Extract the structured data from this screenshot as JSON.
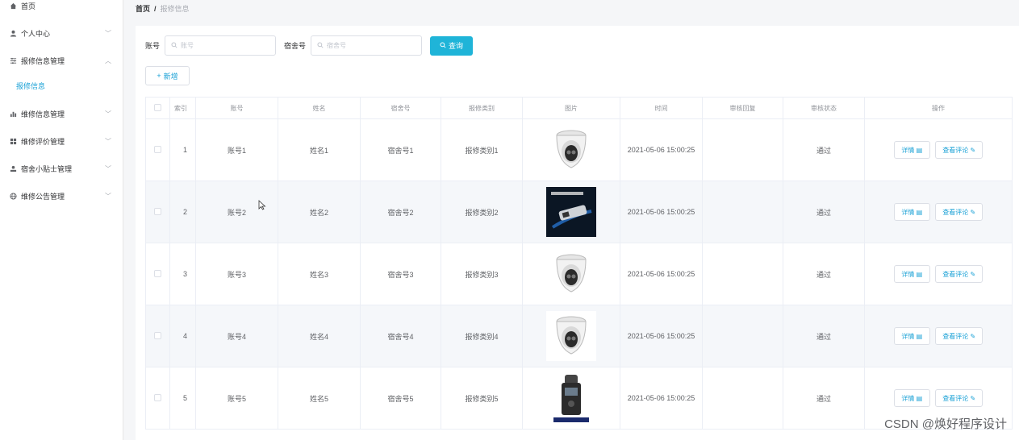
{
  "sidebar": {
    "items": [
      {
        "label": "首页",
        "icon": "home-icon",
        "has_chevron": false
      },
      {
        "label": "个人中心",
        "icon": "user-icon",
        "has_chevron": true
      },
      {
        "label": "报修信息管理",
        "icon": "sliders-icon",
        "has_chevron": true,
        "expanded": true
      },
      {
        "label": "维修信息管理",
        "icon": "bar-chart-icon",
        "has_chevron": true
      },
      {
        "label": "维修评价管理",
        "icon": "grid-icon",
        "has_chevron": true
      },
      {
        "label": "宿舍小贴士管理",
        "icon": "person-icon",
        "has_chevron": true
      },
      {
        "label": "维修公告管理",
        "icon": "globe-icon",
        "has_chevron": true
      }
    ],
    "active_sub": "报修信息"
  },
  "breadcrumb": {
    "home": "首页",
    "sep": "/",
    "current": "报修信息"
  },
  "search": {
    "account_label": "账号",
    "account_placeholder": "账号",
    "dorm_label": "宿舍号",
    "dorm_placeholder": "宿舍号",
    "search_button": "查询"
  },
  "add_button": "新增",
  "table": {
    "columns": [
      "索引",
      "账号",
      "姓名",
      "宿舍号",
      "报修类别",
      "图片",
      "时间",
      "审核回复",
      "审核状态",
      "操作"
    ],
    "rows": [
      {
        "index": "1",
        "account": "账号1",
        "name": "姓名1",
        "dorm": "宿舍号1",
        "category": "报修类别1",
        "image": "dome-camera",
        "time": "2021-05-06 15:00:25",
        "reply": "",
        "status": "通过"
      },
      {
        "index": "2",
        "account": "账号2",
        "name": "姓名2",
        "dorm": "宿舍号2",
        "category": "报修类别2",
        "image": "usb-device",
        "time": "2021-05-06 15:00:25",
        "reply": "",
        "status": "通过"
      },
      {
        "index": "3",
        "account": "账号3",
        "name": "姓名3",
        "dorm": "宿舍号3",
        "category": "报修类别3",
        "image": "dome-camera",
        "time": "2021-05-06 15:00:25",
        "reply": "",
        "status": "通过"
      },
      {
        "index": "4",
        "account": "账号4",
        "name": "姓名4",
        "dorm": "宿舍号4",
        "category": "报修类别4",
        "image": "dome-camera",
        "time": "2021-05-06 15:00:25",
        "reply": "",
        "status": "通过"
      },
      {
        "index": "5",
        "account": "账号5",
        "name": "姓名5",
        "dorm": "宿舍号5",
        "category": "报修类别5",
        "image": "voice-recorder",
        "time": "2021-05-06 15:00:25",
        "reply": "",
        "status": "通过"
      }
    ],
    "detail_label": "详情",
    "comment_label": "查看评论"
  },
  "watermark": "CSDN @焕好程序设计",
  "colors": {
    "accent": "#1fb4d8",
    "link": "#1aa1d6",
    "border": "#ebeef5"
  }
}
